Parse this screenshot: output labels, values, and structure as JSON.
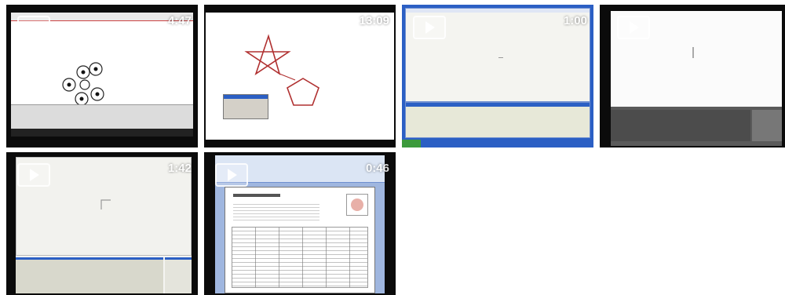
{
  "videos": [
    {
      "duration": "4:47"
    },
    {
      "duration": "13:09"
    },
    {
      "duration": "1:00"
    },
    {
      "duration": ""
    },
    {
      "duration": "1:42"
    },
    {
      "duration": "0:46"
    }
  ],
  "colors": {
    "frame": "#0b0b0b",
    "canvas": "#ffffff",
    "xp_blue": "#2b5fc4",
    "shape_red": "#b03030",
    "word_blue": "#6f8fd0"
  }
}
